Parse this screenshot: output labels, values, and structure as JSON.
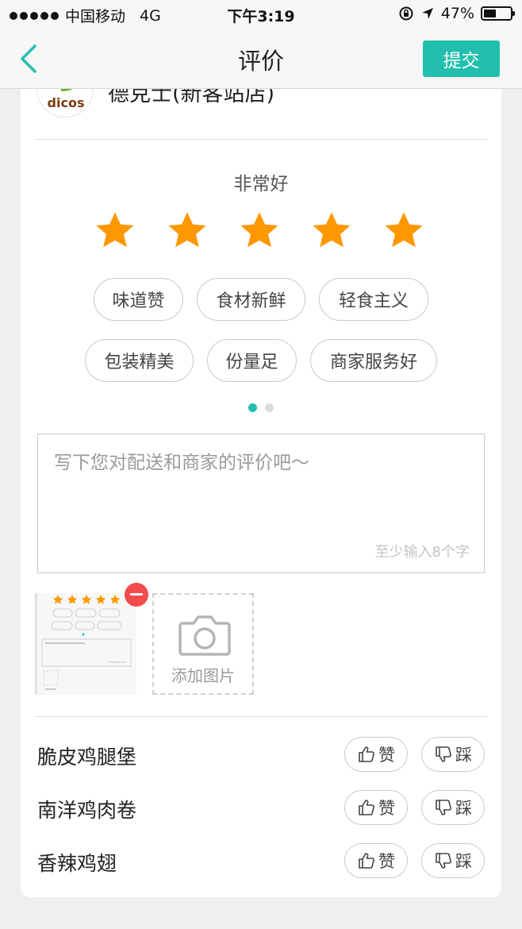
{
  "status_bar": {
    "carrier": "中国移动",
    "network": "4G",
    "time": "下午3:19",
    "battery_percent": "47%",
    "battery_level": 0.47
  },
  "nav": {
    "title": "评价",
    "submit_label": "提交",
    "back_icon": "chevron-left-icon"
  },
  "colors": {
    "accent": "#22bfae",
    "star": "#ff9800",
    "remove": "#f24b4b"
  },
  "shop": {
    "name": "德克士(新客站店)",
    "logo_text": "dicos"
  },
  "rating": {
    "label": "非常好",
    "stars_filled": 5,
    "stars_total": 5
  },
  "tags": [
    "味道赞",
    "食材新鲜",
    "轻食主义",
    "包装精美",
    "份量足",
    "商家服务好"
  ],
  "pager": {
    "pages": 2,
    "current": 1
  },
  "review": {
    "placeholder": "写下您对配送和商家的评价吧～",
    "value": "",
    "hint": "至少输入8个字"
  },
  "photos": {
    "add_label": "添加图片",
    "attached_count": 1
  },
  "dishes": [
    {
      "name": "脆皮鸡腿堡",
      "like_label": "赞",
      "dislike_label": "踩"
    },
    {
      "name": "南洋鸡肉卷",
      "like_label": "赞",
      "dislike_label": "踩"
    },
    {
      "name": "香辣鸡翅",
      "like_label": "赞",
      "dislike_label": "踩"
    }
  ]
}
